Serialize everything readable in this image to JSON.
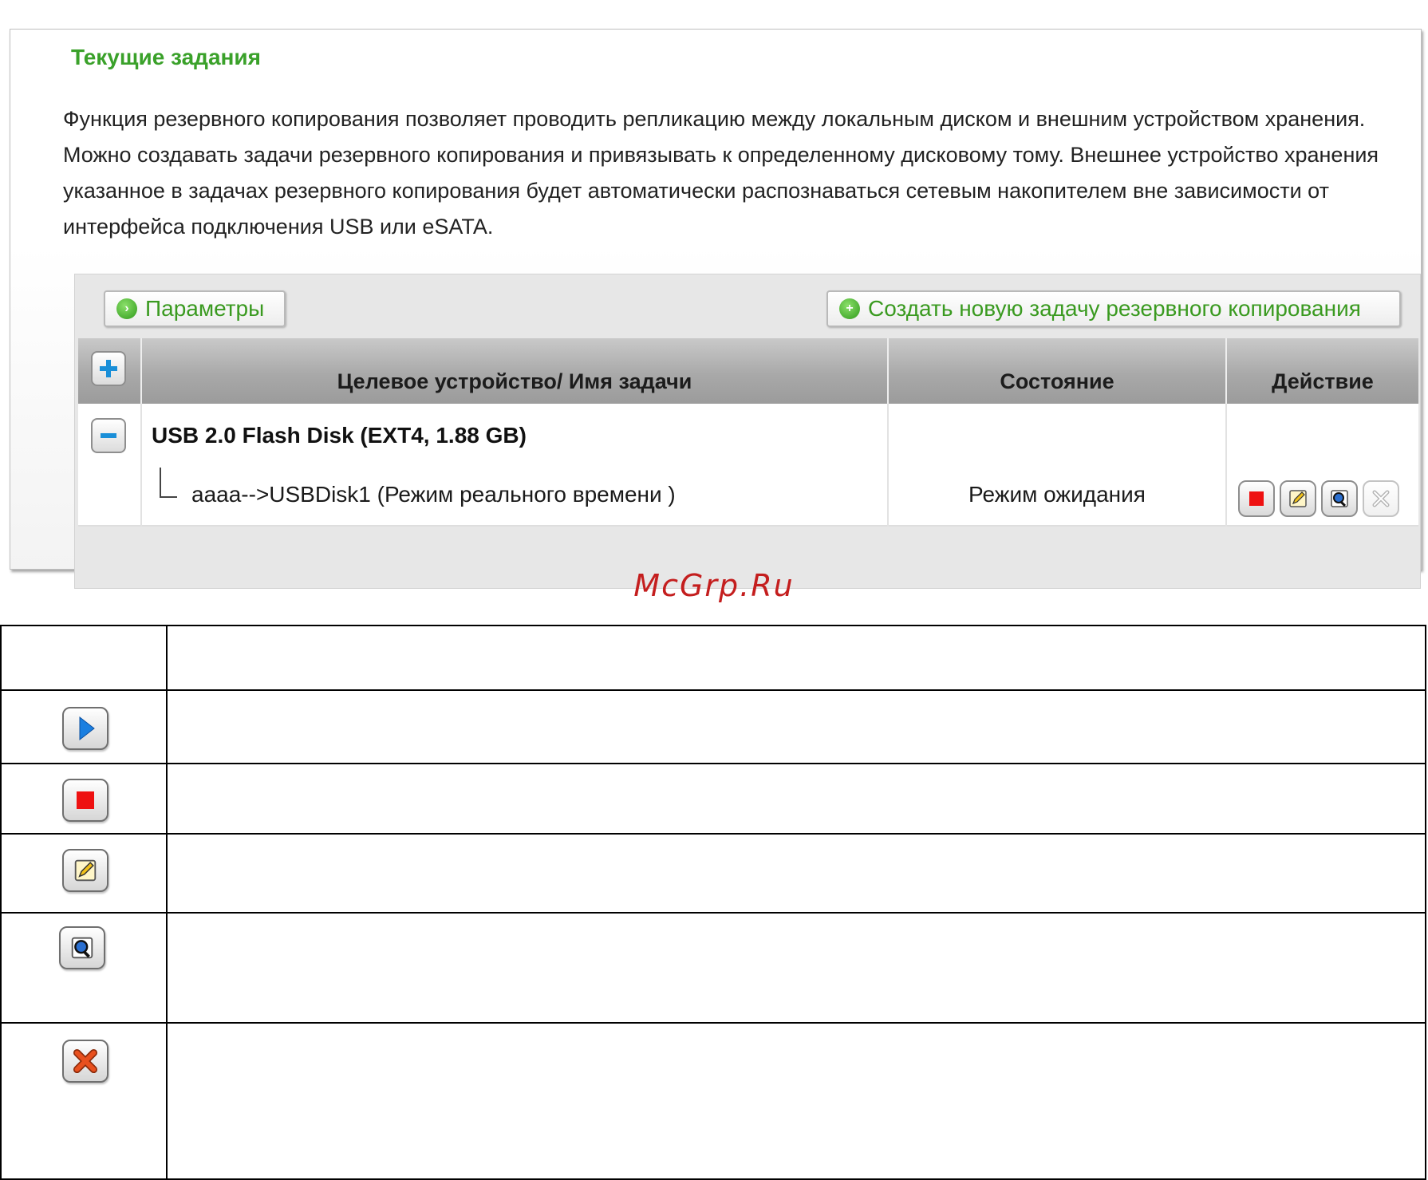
{
  "panel": {
    "title": "Текущие задания",
    "description": "Функция резервного копирования позволяет проводить репликацию между локальным диском и внешним устройством хранения. Можно создавать задачи резервного копирования и привязывать к определенному дисковому тому. Внешнее устройство хранения указанное в задачах резервного копирования будет автоматически распознаваться сетевым накопителем вне зависимости от интерфейса подключения USB или eSATA."
  },
  "toolbar": {
    "params_label": "Параметры",
    "create_label": "Создать новую задачу резервного копирования"
  },
  "table": {
    "columns": [
      "Целевое устройство/ Имя задачи",
      "Состояние",
      "Действие"
    ],
    "disk": "USB 2.0 Flash Disk (EXT4, 1.88 GB)",
    "task": {
      "name": "aaaa-->USBDisk1 (Режим реального времени )",
      "state": "Режим ожидания",
      "actions": [
        "stop-icon",
        "edit-icon",
        "view-icon",
        "delete-icon"
      ]
    }
  },
  "watermark": "McGrp.Ru",
  "legend_table": {
    "header": [
      "",
      ""
    ],
    "rows": [
      {
        "icon": "play-icon",
        "text": ""
      },
      {
        "icon": "stop-icon",
        "text": ""
      },
      {
        "icon": "edit-icon",
        "text": ""
      },
      {
        "icon": "view-icon",
        "text": ""
      },
      {
        "icon": "delete-icon",
        "text": ""
      }
    ]
  },
  "colors": {
    "accent_green": "#3aa12a",
    "stop_red": "#ee1111",
    "add_blue": "#1a8fd8",
    "delete_orange": "#e8501e",
    "watermark_red": "#c41e1e"
  }
}
